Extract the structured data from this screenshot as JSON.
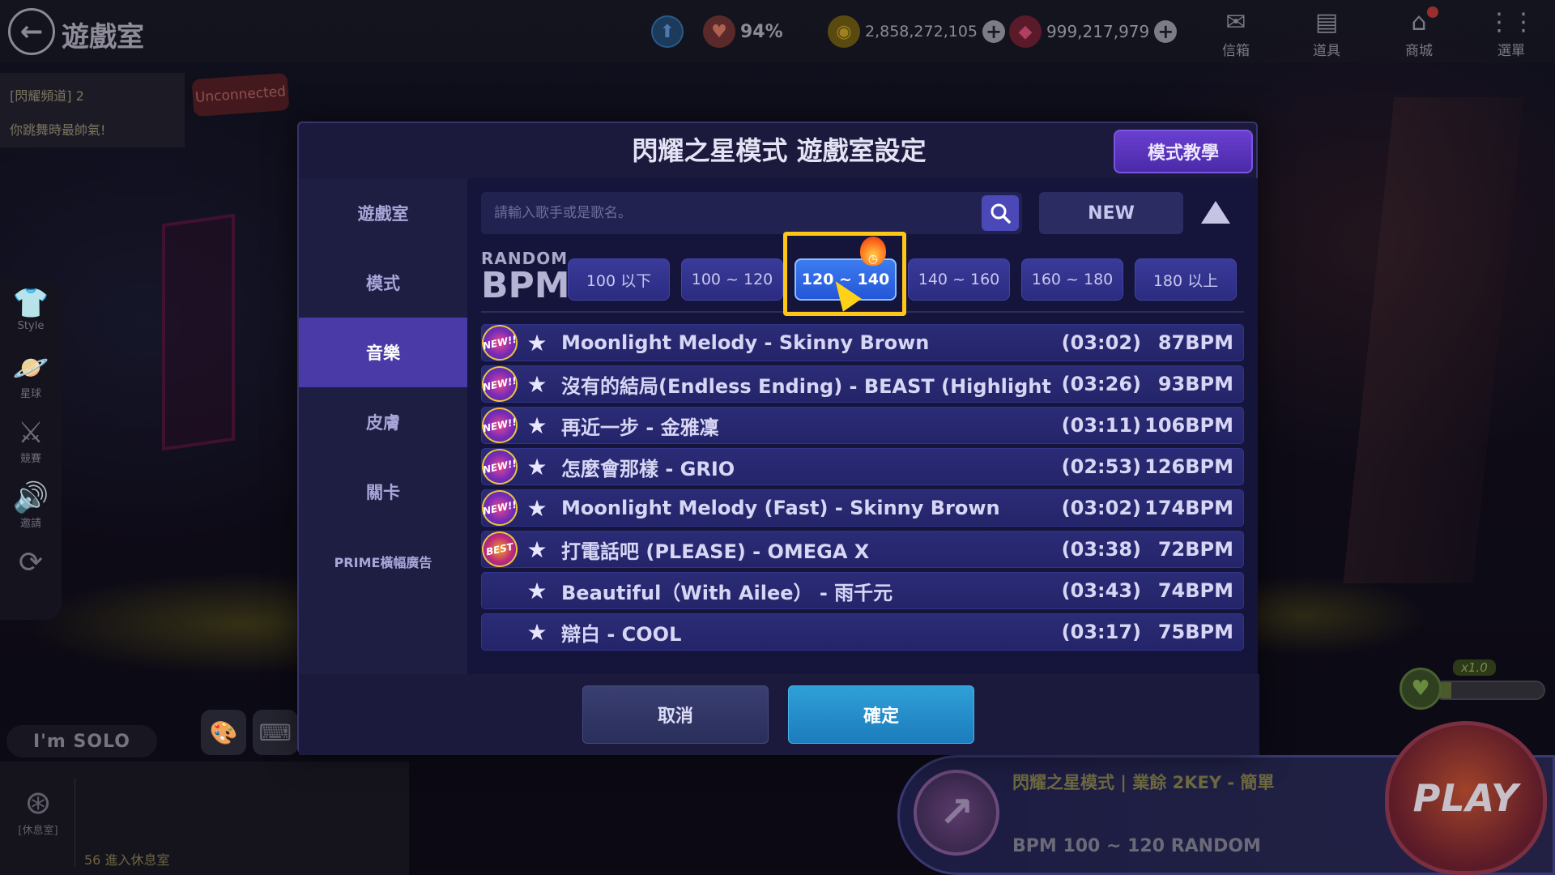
{
  "header": {
    "room_title": "遊戲室",
    "level_badge": "",
    "heart_percent": "94%",
    "gold": "2,858,272,105",
    "gems": "999,217,979",
    "menu": [
      {
        "label": "信箱",
        "glyph": "✉"
      },
      {
        "label": "道具",
        "glyph": "▤"
      },
      {
        "label": "商城",
        "glyph": "⌂"
      },
      {
        "label": "選單",
        "glyph": "⋮⋮"
      }
    ]
  },
  "chat": {
    "channel_line": "[閃耀頻道] 2",
    "message": "你跳舞時最帥氣!",
    "unconnected": "Unconnected"
  },
  "side_nav": [
    {
      "label": "Style",
      "glyph": "👕"
    },
    {
      "label": "星球",
      "glyph": "🪐"
    },
    {
      "label": "競賽",
      "glyph": "⚔"
    },
    {
      "label": "邀請",
      "glyph": "🔊"
    },
    {
      "label": "",
      "glyph": "⟳"
    }
  ],
  "bottom_left": {
    "solo_label": "I'm SOLO",
    "lounge_label": "[休息室]",
    "lounge_message": "56 進入休息室"
  },
  "bottom_right": {
    "mode_info": "閃耀之星模式 | 業餘 2KEY - 簡單",
    "bpm_info": "BPM 100 ~ 120 RANDOM",
    "play_label": "PLAY",
    "multiplier": "x1.0",
    "gauge_fill_percent": 15
  },
  "modal": {
    "title": "閃耀之星模式 遊戲室設定",
    "tutorial_label": "模式教學",
    "tabs": [
      {
        "label": "遊戲室",
        "active": false
      },
      {
        "label": "模式",
        "active": false
      },
      {
        "label": "音樂",
        "active": true
      },
      {
        "label": "皮膚",
        "active": false
      },
      {
        "label": "關卡",
        "active": false
      },
      {
        "label": "PRIME橫幅廣告",
        "active": false
      }
    ],
    "search": {
      "value": "",
      "placeholder": "請輸入歌手或是歌名。"
    },
    "new_label": "NEW",
    "bpm_random_label": "RANDOM",
    "bpm_label": "BPM",
    "bpm_filters": [
      {
        "label": "100 以下",
        "selected": false
      },
      {
        "label": "100 ~ 120",
        "selected": false
      },
      {
        "label": "120 ~ 140",
        "selected": true
      },
      {
        "label": "140 ~ 160",
        "selected": false
      },
      {
        "label": "160 ~ 180",
        "selected": false
      },
      {
        "label": "180 以上",
        "selected": false
      }
    ],
    "songs": [
      {
        "badge": "NEW!!",
        "title": "Moonlight Melody - Skinny Brown",
        "duration": "(03:02)",
        "bpm": "87BPM"
      },
      {
        "badge": "NEW!!",
        "title": "沒有的結局(Endless Ending) - BEAST (Highlight)",
        "duration": "(03:26)",
        "bpm": "93BPM"
      },
      {
        "badge": "NEW!!",
        "title": "再近一步 - 金雅凜",
        "duration": "(03:11)",
        "bpm": "106BPM"
      },
      {
        "badge": "NEW!!",
        "title": "怎麼會那樣 - GRIO",
        "duration": "(02:53)",
        "bpm": "126BPM"
      },
      {
        "badge": "NEW!!",
        "title": "Moonlight Melody (Fast) - Skinny Brown",
        "duration": "(03:02)",
        "bpm": "174BPM"
      },
      {
        "badge": "BEST",
        "title": "打電話吧 (PLEASE) - OMEGA X",
        "duration": "(03:38)",
        "bpm": "72BPM"
      },
      {
        "badge": "",
        "title": "Beautiful（With Ailee） - 雨千元",
        "duration": "(03:43)",
        "bpm": "74BPM"
      },
      {
        "badge": "",
        "title": "辯白 - COOL",
        "duration": "(03:17)",
        "bpm": "75BPM"
      }
    ],
    "cancel_label": "取消",
    "confirm_label": "確定"
  }
}
